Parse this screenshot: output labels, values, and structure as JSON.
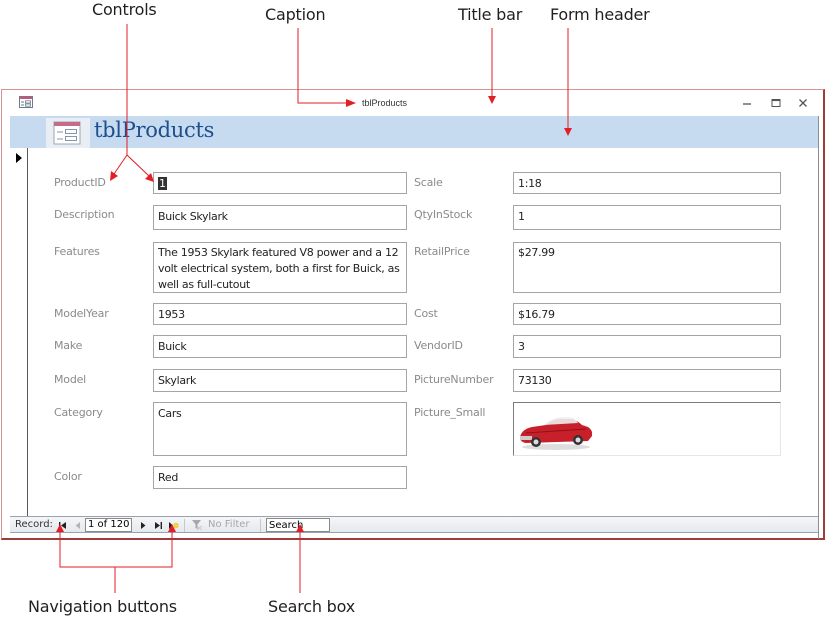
{
  "callouts": {
    "controls": "Controls",
    "caption": "Caption",
    "title_bar": "Title bar",
    "form_header": "Form header",
    "navigation_buttons": "Navigation buttons",
    "search_box": "Search box"
  },
  "window": {
    "caption": "tblProducts",
    "controls": {
      "minimize": "minimize-icon",
      "maximize": "maximize-icon",
      "close": "close-icon"
    }
  },
  "form_header": {
    "title": "tblProducts",
    "icon": "form-icon"
  },
  "fields_left": [
    {
      "label": "ProductID",
      "value": "1"
    },
    {
      "label": "Description",
      "value": "Buick Skylark"
    },
    {
      "label": "Features",
      "value": "The 1953 Skylark featured V8 power and a 12 volt electrical system, both a first for Buick, as well as full-cutout"
    },
    {
      "label": "ModelYear",
      "value": "1953"
    },
    {
      "label": "Make",
      "value": "Buick"
    },
    {
      "label": "Model",
      "value": "Skylark"
    },
    {
      "label": "Category",
      "value": "Cars"
    },
    {
      "label": "Color",
      "value": "Red"
    }
  ],
  "fields_right": [
    {
      "label": "Scale",
      "value": "1:18"
    },
    {
      "label": "QtyInStock",
      "value": "1"
    },
    {
      "label": "RetailPrice",
      "value": "$27.99"
    },
    {
      "label": "Cost",
      "value": "$16.79"
    },
    {
      "label": "VendorID",
      "value": "3"
    },
    {
      "label": "PictureNumber",
      "value": "73130"
    },
    {
      "label": "Picture_Small",
      "value": "red convertible car image"
    }
  ],
  "navigation": {
    "record_label": "Record:",
    "current": "1 of 120",
    "filter_label": "No Filter",
    "search_placeholder": "Search",
    "buttons": [
      "first-record",
      "previous-record",
      "next-record",
      "last-record",
      "new-record"
    ]
  },
  "colors": {
    "header_bg": "#c6dbf0",
    "header_title": "#1f4e8c",
    "callout_red": "#e31e24",
    "window_border": "#9e3c3a"
  }
}
